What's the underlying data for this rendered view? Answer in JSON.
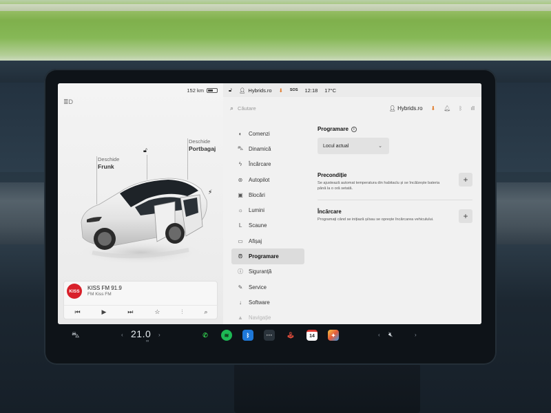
{
  "car_panel": {
    "range": "152 km",
    "frunk_action": "Deschide",
    "frunk_label": "Frunk",
    "trunk_action": "Deschide",
    "trunk_label": "Portbagaj"
  },
  "music": {
    "logo_text": "KISS",
    "station_name": "KISS FM 91.9",
    "station_sub": "FM Kiss FM"
  },
  "status_bar": {
    "profile": "Hybrids.ro",
    "sos": "SOS",
    "time": "12:18",
    "temperature": "17°C"
  },
  "settings": {
    "search_placeholder": "Căutare",
    "profile_name": "Hybrids.ro",
    "menu": [
      {
        "label": "Comenzi",
        "icon": "toggle-icon"
      },
      {
        "label": "Dinamică",
        "icon": "car-icon"
      },
      {
        "label": "Încărcare",
        "icon": "bolt-icon"
      },
      {
        "label": "Autopilot",
        "icon": "steering-wheel-icon"
      },
      {
        "label": "Blocări",
        "icon": "lock-icon"
      },
      {
        "label": "Lumini",
        "icon": "sun-icon"
      },
      {
        "label": "Scaune",
        "icon": "seat-icon"
      },
      {
        "label": "Afișaj",
        "icon": "display-icon"
      },
      {
        "label": "Programare",
        "icon": "alarm-clock-icon",
        "active": true
      },
      {
        "label": "Siguranță",
        "icon": "info-icon"
      },
      {
        "label": "Service",
        "icon": "wrench-icon"
      },
      {
        "label": "Software",
        "icon": "download-icon"
      },
      {
        "label": "Navigație",
        "icon": "navigation-icon",
        "faded": true
      }
    ],
    "content": {
      "section_title": "Programare",
      "dropdown_value": "Locul actual",
      "preconditioning_title": "Precondiție",
      "preconditioning_desc": "Se ajustează automat temperatura din habitaclu și se încălzește bateria până la o oră setată.",
      "charging_title": "Încărcare",
      "charging_desc": "Programați când se inițiază și/sau se oprește încărcarea vehiculului."
    }
  },
  "bottom_bar": {
    "cabin_temp": "21.0",
    "calendar_day": "14"
  },
  "colors": {
    "kiss_red": "#d8202a",
    "phone_green": "#2fbf4a",
    "spotify_green": "#1db954",
    "bluetooth_blue": "#1e78d8",
    "calendar_red": "#e23b33",
    "accent_orange": "#e07a2a"
  }
}
